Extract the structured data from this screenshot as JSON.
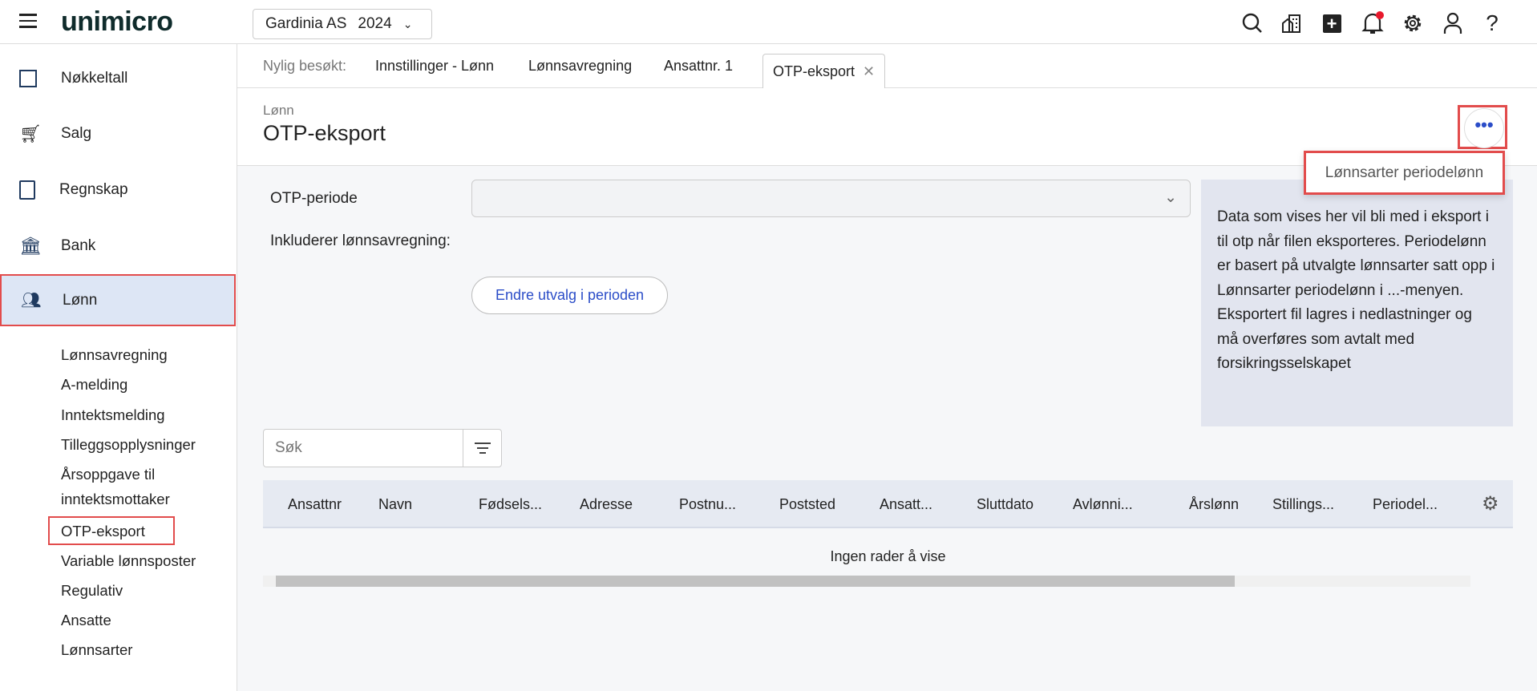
{
  "header": {
    "logo": "unimicro",
    "company": "Gardinia AS",
    "year": "2024"
  },
  "sidebar": {
    "items": [
      {
        "label": "Nøkkeltall"
      },
      {
        "label": "Salg"
      },
      {
        "label": "Regnskap"
      },
      {
        "label": "Bank"
      },
      {
        "label": "Lønn"
      }
    ],
    "subitems": [
      "Lønnsavregning",
      "A-melding",
      "Inntektsmelding",
      "Tilleggsopplysninger",
      "Årsoppgave til",
      "inntektsmottaker",
      "OTP-eksport",
      "Variable lønnsposter",
      "Regulativ",
      "Ansatte",
      "Lønnsarter"
    ]
  },
  "tabs": {
    "label": "Nylig besøkt:",
    "items": [
      "Innstillinger - Lønn",
      "Lønnsavregning",
      "Ansattnr. 1",
      "OTP-eksport"
    ]
  },
  "page": {
    "breadcrumb": "Lønn",
    "title": "OTP-eksport",
    "menu_item": "Lønnsarter periodelønn"
  },
  "form": {
    "period_label": "OTP-periode",
    "period_value": "",
    "includes_label": "Inkluderer lønnsavregning:",
    "change_button": "Endre utvalg i perioden"
  },
  "info": "Data som vises her vil bli med i eksport i til otp når filen eksporteres. Periodelønn er basert på utvalgte lønnsarter satt opp i Lønnsarter periodelønn i ...-menyen. Eksportert fil lagres i nedlastninger og må overføres som avtalt med forsikringsselskapet",
  "table": {
    "search_placeholder": "Søk",
    "columns": [
      "Ansattnr",
      "Navn",
      "Fødsels...",
      "Adresse",
      "Postnu...",
      "Poststed",
      "Ansatt...",
      "Sluttdato",
      "Avlønni...",
      "Årslønn",
      "Stillings...",
      "Periodel..."
    ],
    "empty": "Ingen rader å vise"
  }
}
